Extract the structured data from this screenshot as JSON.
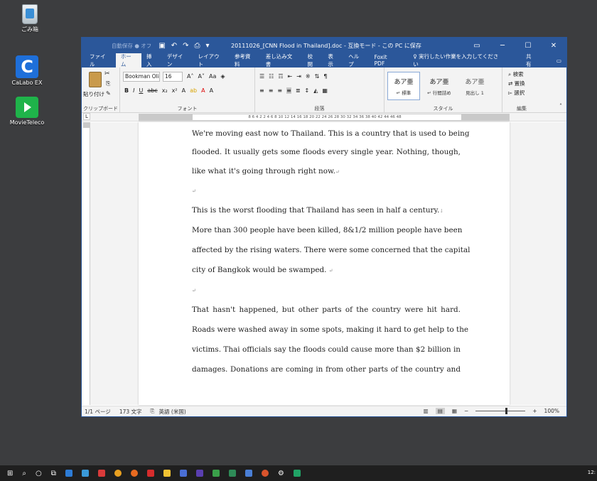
{
  "desktop": {
    "icons": [
      {
        "label": "ごみ箱"
      },
      {
        "label": "CaLabo EX"
      },
      {
        "label": "MovieTeleco"
      }
    ]
  },
  "titlebar": {
    "autosave": "自動保存 ● オフ",
    "doc_title": "20111026_[CNN Flood in Thailand].doc  -  互換モード  -  この PC に保存"
  },
  "tabs": [
    "ファイル",
    "ホーム",
    "挿入",
    "デザイン",
    "レイアウト",
    "参考資料",
    "差し込み文書",
    "校閲",
    "表示",
    "ヘルプ",
    "Foxit PDF"
  ],
  "tell_me": "♀ 実行したい作業を入力してください",
  "share": "共有",
  "ribbon": {
    "paste": "貼り付け",
    "clipboard": "クリップボード",
    "font_name": "Bookman Oli",
    "font_size": "16",
    "font_group": "フォント",
    "para_group": "段落",
    "style_group": "スタイル",
    "styles": [
      {
        "sample": "あア亜",
        "name": "↵ 標準"
      },
      {
        "sample": "あア亜",
        "name": "↵ 行間詰め"
      },
      {
        "sample": "あア亜",
        "name": "見出し 1"
      }
    ],
    "edit_group": "編集",
    "find": "検索",
    "replace": "置換",
    "select": "選択"
  },
  "ruler_numbers": "8   6   4   2       2   4   6   8  10  12  14  16  18  20  22  24  26  28  30  32  34  36  38  40  42  44  46  48",
  "document": {
    "lines": [
      "We're moving east now to Thailand. This is a country that is used to being",
      "flooded.   It usually gets some floods every single year.   Nothing, though,",
      "like what it's going through right now.",
      "",
      "This is the worst flooding that Thailand has seen in half a century.",
      "More than 300 people have been killed, 8&1/2 million people have been",
      "affected by the rising waters. There were some concerned that the capital",
      "city of Bangkok would be swamped.",
      "",
      "That hasn't happened, but other parts of the country were hit hard.",
      "Roads were washed away in some spots, making it hard to get help to the",
      "victims. Thai officials say the floods could cause more than $2 billion in",
      "damages. Donations are coming in from other parts of the country and"
    ]
  },
  "statusbar": {
    "page": "1/1 ページ",
    "words": "173 文字",
    "lang": "英語 (米国)",
    "zoom": "100%"
  },
  "clock": "12:"
}
